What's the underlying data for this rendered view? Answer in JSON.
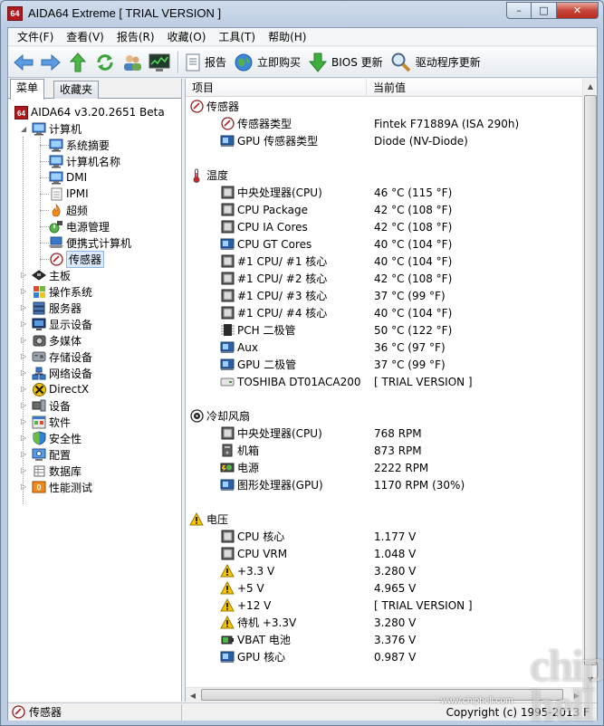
{
  "window": {
    "title": "AIDA64 Extreme  [ TRIAL VERSION ]",
    "app_icon_text": "64",
    "minimize": "–",
    "maximize": "□",
    "close": "✕"
  },
  "menu": [
    "文件(F)",
    "查看(V)",
    "报告(R)",
    "收藏(O)",
    "工具(T)",
    "帮助(H)"
  ],
  "toolbar": {
    "report": "报告",
    "buy": "立即购买",
    "bios": "BIOS 更新",
    "driver": "驱动程序更新"
  },
  "left": {
    "tabs": [
      "菜单",
      "收藏夹"
    ],
    "root": "AIDA64 v3.20.2651 Beta",
    "computer": "计算机",
    "computer_children": [
      "系统摘要",
      "计算机名称",
      "DMI",
      "IPMI",
      "超频",
      "电源管理",
      "便携式计算机",
      "传感器"
    ],
    "top_items": [
      "主板",
      "操作系统",
      "服务器",
      "显示设备",
      "多媒体",
      "存储设备",
      "网络设备",
      "DirectX",
      "设备",
      "软件",
      "安全性",
      "配置",
      "数据库",
      "性能测试"
    ]
  },
  "right": {
    "columns": [
      "项目",
      "当前值"
    ],
    "groups": [
      {
        "title": "传感器",
        "icon": "sensor-icon",
        "rows": [
          {
            "icon": "sensor-icon",
            "name": "传感器类型",
            "value": "Fintek F71889A  (ISA 290h)"
          },
          {
            "icon": "gpu-icon",
            "name": "GPU 传感器类型",
            "value": "Diode  (NV-Diode)"
          }
        ]
      },
      {
        "title": "温度",
        "icon": "thermometer-icon",
        "rows": [
          {
            "icon": "cpu-icon",
            "name": "中央处理器(CPU)",
            "value": "46 °C  (115 °F)"
          },
          {
            "icon": "cpu-icon",
            "name": "CPU Package",
            "value": "42 °C  (108 °F)"
          },
          {
            "icon": "cpu-icon",
            "name": "CPU IA Cores",
            "value": "42 °C  (108 °F)"
          },
          {
            "icon": "gpu-icon",
            "name": "CPU GT Cores",
            "value": "40 °C  (104 °F)"
          },
          {
            "icon": "cpu-icon",
            "name": "#1 CPU/ #1 核心",
            "value": "40 °C  (104 °F)"
          },
          {
            "icon": "cpu-icon",
            "name": "#1 CPU/ #2 核心",
            "value": "42 °C  (108 °F)"
          },
          {
            "icon": "cpu-icon",
            "name": "#1 CPU/ #3 核心",
            "value": "37 °C  (99 °F)"
          },
          {
            "icon": "cpu-icon",
            "name": "#1 CPU/ #4 核心",
            "value": "40 °C  (104 °F)"
          },
          {
            "icon": "chip-icon",
            "name": "PCH 二极管",
            "value": "50 °C  (122 °F)"
          },
          {
            "icon": "gpu-icon",
            "name": "Aux",
            "value": "36 °C  (97 °F)"
          },
          {
            "icon": "gpu-icon",
            "name": "GPU 二极管",
            "value": "37 °C  (99 °F)"
          },
          {
            "icon": "disk-icon",
            "name": "TOSHIBA DT01ACA200",
            "value": "[ TRIAL VERSION ]"
          }
        ]
      },
      {
        "title": "冷却风扇",
        "icon": "fan-icon",
        "rows": [
          {
            "icon": "cpu-icon",
            "name": "中央处理器(CPU)",
            "value": "768 RPM"
          },
          {
            "icon": "case-icon",
            "name": "机箱",
            "value": "873 RPM"
          },
          {
            "icon": "power-icon",
            "name": "电源",
            "value": "2222 RPM"
          },
          {
            "icon": "gpu-icon",
            "name": "图形处理器(GPU)",
            "value": "1170 RPM  (30%)"
          }
        ]
      },
      {
        "title": "电压",
        "icon": "warning-icon",
        "rows": [
          {
            "icon": "cpu-icon",
            "name": "CPU 核心",
            "value": "1.177 V"
          },
          {
            "icon": "cpu-icon",
            "name": "CPU VRM",
            "value": "1.048 V"
          },
          {
            "icon": "warning-icon",
            "name": "+3.3 V",
            "value": "3.280 V"
          },
          {
            "icon": "warning-icon",
            "name": "+5 V",
            "value": "4.965 V"
          },
          {
            "icon": "warning-icon",
            "name": "+12 V",
            "value": "[ TRIAL VERSION ]"
          },
          {
            "icon": "warning-icon",
            "name": "待机 +3.3V",
            "value": "3.280 V"
          },
          {
            "icon": "battery-icon",
            "name": "VBAT 电池",
            "value": "3.376 V"
          },
          {
            "icon": "gpu-icon",
            "name": "GPU 核心",
            "value": "0.987 V"
          }
        ]
      }
    ]
  },
  "status": {
    "left": "传感器",
    "right": "Copyright (c) 1995-2013 F"
  },
  "watermark": {
    "big": "chip hell",
    "url": "www.chiphell.com"
  }
}
